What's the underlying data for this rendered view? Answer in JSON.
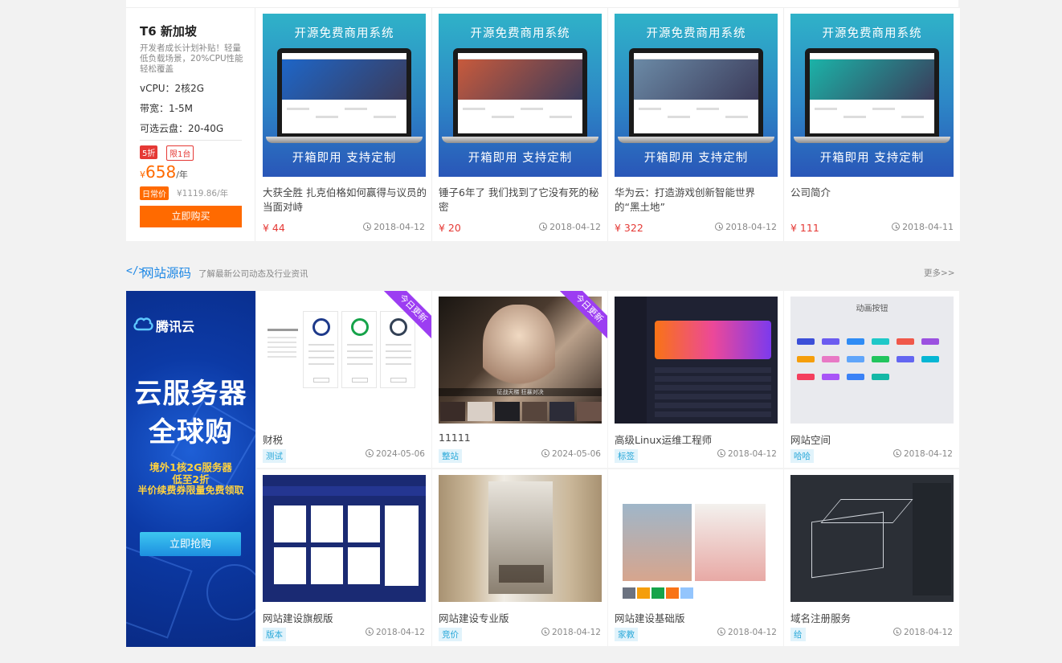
{
  "server": {
    "title": "T6 新加坡",
    "desc": "开发者成长计划补贴！轻量低负载场景，20%CPU性能轻松覆盖",
    "vcpu": "vCPU：2核2G",
    "bandwidth": "带宽：1-5M",
    "disk": "可选云盘：20-40G",
    "discount": "5折",
    "limit": "限1台",
    "yen": "¥",
    "price": "658",
    "unit": "/年",
    "daily_label": "日常价",
    "daily_price": "¥1119.86/年",
    "buy": "立即购买"
  },
  "product_banner": {
    "top": "开源免费商用系统",
    "bottom": "开箱即用  支持定制"
  },
  "products": [
    {
      "title": "大获全胜 扎克伯格如何赢得与议员的当面对峙",
      "price": "¥ 44",
      "date": "2018-04-12",
      "accent": "#1e66c8"
    },
    {
      "title": "锤子6年了 我们找到了它没有死的秘密",
      "price": "¥ 20",
      "date": "2018-04-12",
      "accent": "#c85a3c"
    },
    {
      "title": "华为云：打造游戏创新智能世界的“黑土地”",
      "price": "¥ 322",
      "date": "2018-04-12",
      "accent": "#6b8aa6"
    },
    {
      "title": "公司简介",
      "price": "¥ 111",
      "date": "2018-04-11",
      "accent": "#1bb3a8"
    }
  ],
  "section": {
    "icon": "</>",
    "title": "网站源码",
    "subtitle": "了解最新公司动态及行业资讯",
    "more": "更多>>"
  },
  "ad": {
    "brand": "腾讯云",
    "line1": "云服务器",
    "line2": "全球购",
    "promo1": "境外1核2G服务器",
    "promo2": "低至2折",
    "promo3": "半价续费券限量免费领取",
    "button": "立即抢购"
  },
  "sources": [
    {
      "title": "财税",
      "tag": "测试",
      "date": "2024-05-06",
      "ribbon": "今日更新"
    },
    {
      "title": "11111",
      "tag": "整站",
      "date": "2024-05-06",
      "ribbon": "今日更新"
    },
    {
      "title": "高级Linux运维工程师",
      "tag": "标签",
      "date": "2018-04-12"
    },
    {
      "title": "网站空间",
      "tag": "哈哈",
      "date": "2018-04-12"
    },
    {
      "title": "网站建设旗舰版",
      "tag": "版本",
      "date": "2018-04-12"
    },
    {
      "title": "网站建设专业版",
      "tag": "竞价",
      "date": "2018-04-12"
    },
    {
      "title": "网站建设基础版",
      "tag": "家教",
      "date": "2018-04-12"
    },
    {
      "title": "域名注册服务",
      "tag": "给",
      "date": "2018-04-12"
    }
  ],
  "thumbs": {
    "anim_title": "动画按钮",
    "anim_colors": [
      "#3b4fd8",
      "#6b5cf0",
      "#2f8cf5",
      "#1fc8c8",
      "#f0584a",
      "#9b51e0",
      "#f59e0b",
      "#e879c5",
      "#60a5fa",
      "#22c55e",
      "#6366f1",
      "#06b6d4",
      "#f43f5e",
      "#a855f7",
      "#3b82f6",
      "#14b8a6"
    ],
    "poster_caption": "征战天梯 狂暴对决"
  }
}
